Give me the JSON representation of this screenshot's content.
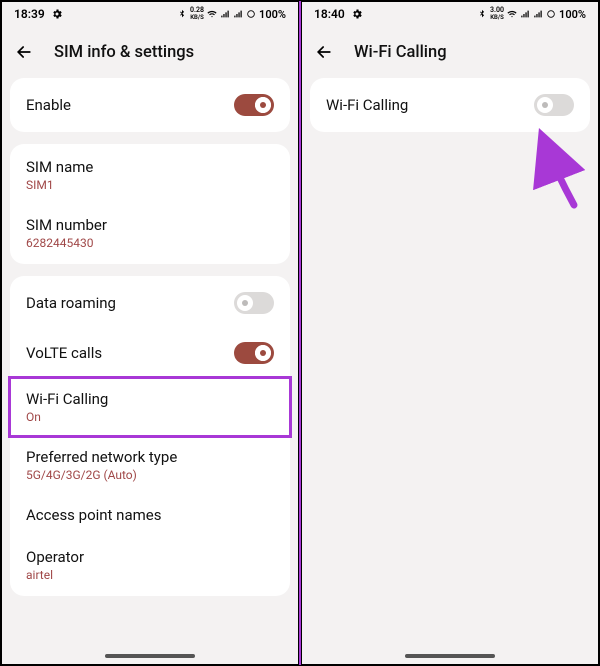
{
  "left": {
    "time": "18:39",
    "net_rate": "0.28",
    "net_unit": "KB/S",
    "battery": "100%",
    "title": "SIM info & settings",
    "enable_label": "Enable",
    "sim_name_label": "SIM name",
    "sim_name_value": "SIM1",
    "sim_number_label": "SIM number",
    "sim_number_value": "6282445430",
    "data_roaming_label": "Data roaming",
    "volte_label": "VoLTE calls",
    "wifi_calling_label": "Wi-Fi Calling",
    "wifi_calling_value": "On",
    "pref_net_label": "Preferred network type",
    "pref_net_value": "5G/4G/3G/2G (Auto)",
    "apn_label": "Access point names",
    "operator_label": "Operator",
    "operator_value": "airtel"
  },
  "right": {
    "time": "18:40",
    "net_rate": "3.00",
    "net_unit": "KB/S",
    "battery": "100%",
    "title": "Wi-Fi Calling",
    "wifi_calling_label": "Wi-Fi Calling"
  }
}
